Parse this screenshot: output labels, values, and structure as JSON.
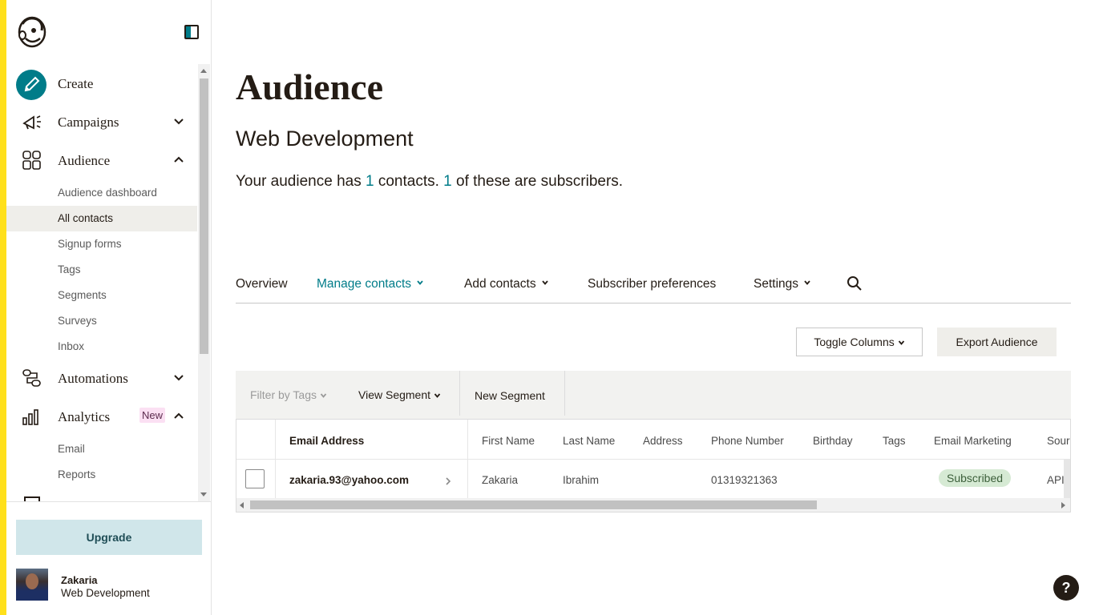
{
  "sidebar": {
    "logo": "mailchimp-logo",
    "nav": [
      {
        "label": "Create",
        "icon": "pencil-icon"
      },
      {
        "label": "Campaigns",
        "icon": "megaphone-icon"
      },
      {
        "label": "Audience",
        "icon": "audience-icon"
      },
      {
        "label": "Automations",
        "icon": "automation-icon"
      },
      {
        "label": "Analytics",
        "icon": "bar-chart-icon",
        "badge": "New"
      }
    ],
    "audience_sub": [
      "Audience dashboard",
      "All contacts",
      "Signup forms",
      "Tags",
      "Segments",
      "Surveys",
      "Inbox"
    ],
    "analytics_sub": [
      "Email",
      "Reports"
    ],
    "active_sub": "All contacts",
    "upgrade_label": "Upgrade",
    "user": {
      "name": "Zakaria",
      "org": "Web Development"
    }
  },
  "main": {
    "title": "Audience",
    "audience_name": "Web Development",
    "summary": {
      "prefix": "Your audience has ",
      "contacts": "1",
      "middle": " contacts. ",
      "subscribers": "1",
      "suffix": " of these are subscribers."
    },
    "tabs": [
      "Overview",
      "Manage contacts",
      "Add contacts",
      "Subscriber preferences",
      "Settings"
    ],
    "active_tab": "Manage contacts",
    "toggle_columns": "Toggle Columns",
    "export_audience": "Export Audience",
    "filter_by_tags": "Filter by Tags",
    "view_segment": "View Segment",
    "new_segment": "New Segment",
    "table": {
      "headers": [
        "Email Address",
        "First Name",
        "Last Name",
        "Address",
        "Phone Number",
        "Birthday",
        "Tags",
        "Email Marketing",
        "Sour"
      ],
      "rows": [
        {
          "email": "zakaria.93@yahoo.com",
          "first_name": "Zakaria",
          "last_name": "Ibrahim",
          "address": "",
          "phone": "01319321363",
          "birthday": "",
          "tags": "",
          "email_marketing": "Subscribed",
          "source": "API"
        }
      ]
    }
  },
  "help_label": "?",
  "colors": {
    "accent": "#007c89",
    "brand_yellow": "#ffe01b",
    "subscribed_bg": "#d6ead4",
    "upgrade_bg": "#d0e6ea"
  }
}
